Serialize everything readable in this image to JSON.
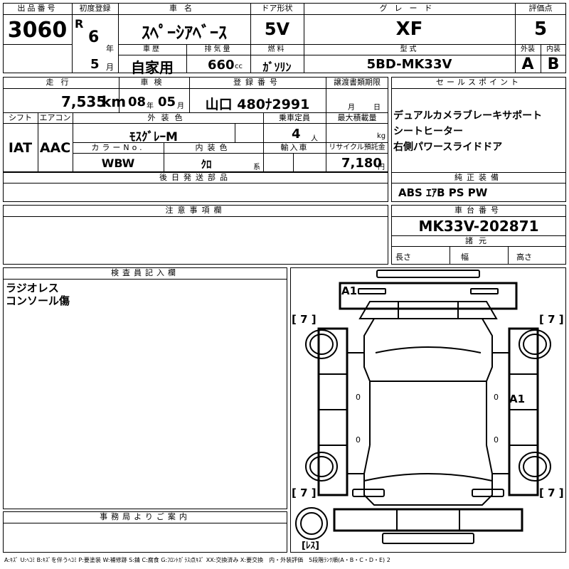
{
  "headers": {
    "lot_no": "出品番号",
    "first_reg": "初度登録",
    "car_name": "車名",
    "door": "ドア形状",
    "grade": "グレード",
    "score": "評価点",
    "history": "車歴",
    "displacement": "排気量",
    "fuel": "燃料",
    "model": "型式",
    "exterior": "外装",
    "interior": "内装",
    "mileage": "走行",
    "inspection": "車検",
    "reg_no": "登録番号",
    "transfer_doc": "譲渡書類期限",
    "sales_points": "セールスポイント",
    "shift": "シフト",
    "aircon": "エアコン",
    "ext_color": "外装色",
    "capacity": "乗車定員",
    "max_load": "最大積載量",
    "color_no": "カラーNo.",
    "int_color": "内装色",
    "import": "輸入車",
    "recycle": "リサイクル預託金",
    "later_parts": "後日発送部品",
    "genuine_equip": "純正装備",
    "notes": "注意事項欄",
    "chassis_no": "車台番号",
    "specs": "諸元",
    "inspector": "検査員記入欄",
    "office": "事務局よりご案内"
  },
  "values": {
    "lot_no": "3060",
    "era": "R",
    "year": "6",
    "year_unit": "年",
    "month": "5",
    "month_unit": "月",
    "car_name": "ｽﾍﾟｰｼｱﾍﾞｰｽ",
    "door": "5V",
    "grade": "XF",
    "score": "5",
    "history": "自家用",
    "displacement": "660",
    "displacement_unit": "cc",
    "fuel": "ｶﾞｿﾘﾝ",
    "model": "5BD-MK33V",
    "exterior": "A",
    "interior": "B",
    "mileage": "7,535",
    "mileage_unit": "km",
    "insp_year": "08",
    "insp_year_unit": "年",
    "insp_month": "05",
    "insp_month_unit": "月",
    "reg_no": "山口 480ﾅ2991",
    "transfer_month_unit": "月",
    "transfer_day_unit": "日",
    "shift": "IAT",
    "aircon": "AAC",
    "ext_color": "ﾓｽｸﾞﾚｰM",
    "capacity": "4",
    "capacity_unit": "人",
    "max_load_unit": "kg",
    "color_no": "WBW",
    "int_color": "ｸﾛ",
    "int_color_unit": "系",
    "recycle": "7,180",
    "recycle_unit": "円",
    "chassis_no": "MK33V-202871",
    "spec_length": "長さ",
    "spec_width": "幅",
    "spec_height": "高さ"
  },
  "sales_points": [
    "デュアルカメラブレーキサポート",
    "シートヒーター",
    "右側パワースライドドア"
  ],
  "genuine_equip": "ABS ｴｱB PS PW",
  "inspector_notes": [
    "ラジオレス",
    "コンソール傷"
  ],
  "diagram": {
    "front_left_tire": "[ 7 ]",
    "front_right_tire": "[ 7 ]",
    "rear_left_tire": "[ 7 ]",
    "rear_right_tire": "[ 7 ]",
    "mark_front": "A1",
    "mark_right_door": "A1",
    "spare": "[ﾚｽ]",
    "zero": "0"
  },
  "legend": "A:ｷｽﾞ U:ﾍｺﾐ B:ｷｽﾞを伴うﾍｺﾐ P:要塗装 W:補修跡 S:錆 C:腐食 G:ﾌﾛﾝﾄｶﾞﾗｽ点ｷｽﾞ XX:交換済み X:要交換　内・外装評価　5段階ﾗﾝｸ順(A・B・C・D・E) 2"
}
